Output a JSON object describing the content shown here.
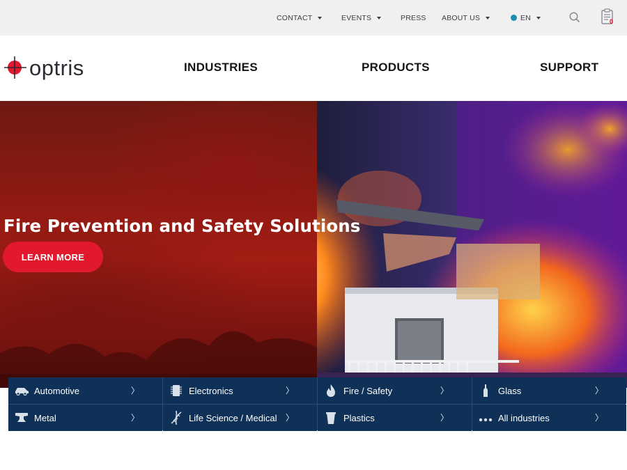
{
  "topbar": {
    "items": [
      {
        "label": "CONTACT",
        "has_dropdown": true
      },
      {
        "label": "EVENTS",
        "has_dropdown": true
      },
      {
        "label": "PRESS",
        "has_dropdown": false
      },
      {
        "label": "ABOUT US",
        "has_dropdown": true
      }
    ],
    "language": "EN",
    "cart_count": "0",
    "icons": [
      "globe-icon",
      "search-icon",
      "clipboard-cart-icon"
    ]
  },
  "brand": {
    "name": "optris",
    "accent": "#e2182d"
  },
  "mainnav": {
    "items": [
      "INDUSTRIES",
      "PRODUCTS",
      "SUPPORT"
    ]
  },
  "hero": {
    "title": "Fire Prevention and Safety Solutions",
    "cta": "LEARN MORE"
  },
  "industries": [
    {
      "label": "Automotive",
      "icon": "car-icon"
    },
    {
      "label": "Electronics",
      "icon": "chip-icon"
    },
    {
      "label": "Fire / Safety",
      "icon": "flame-icon"
    },
    {
      "label": "Glass",
      "icon": "bottle-icon"
    },
    {
      "label": "Metal",
      "icon": "anvil-icon"
    },
    {
      "label": "Life Science / Medical",
      "icon": "dna-icon"
    },
    {
      "label": "Plastics",
      "icon": "cup-icon"
    },
    {
      "label": "All industries",
      "icon": "dots-icon"
    }
  ],
  "colors": {
    "navy": "#0f3057",
    "red": "#e2182d",
    "topbar_bg": "#f0f0f0"
  }
}
